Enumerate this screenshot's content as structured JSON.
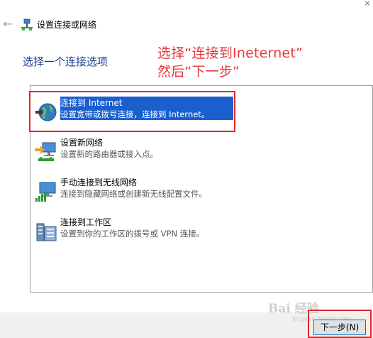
{
  "window": {
    "title": "设置连接或网络"
  },
  "heading": "选择一个连接选项",
  "annotation": {
    "line1": "选择“连接到Ineternet”",
    "line2": "然后“下一步”",
    "color": "#e8393f"
  },
  "options": [
    {
      "title": "连接到 Internet",
      "description": "设置宽带或拨号连接，连接到 Internet。",
      "icon": "globe-icon",
      "selected": true
    },
    {
      "title": "设置新网络",
      "description": "设置新的路由器或接入点。",
      "icon": "new-network-icon",
      "selected": false
    },
    {
      "title": "手动连接到无线网络",
      "description": "连接到隐藏网络或创建新无线配置文件。",
      "icon": "wireless-network-icon",
      "selected": false
    },
    {
      "title": "连接到工作区",
      "description": "设置到你的工作区的拨号或 VPN 连接。",
      "icon": "workplace-icon",
      "selected": false
    }
  ],
  "buttons": {
    "next": "下一步(N)"
  },
  "watermark": {
    "text": "Bai 经验",
    "sub": "jingyan.baidu.com"
  },
  "colors": {
    "selection": "#1b5fcf",
    "heading": "#1b3f8b",
    "highlight_box": "#e0282c"
  }
}
